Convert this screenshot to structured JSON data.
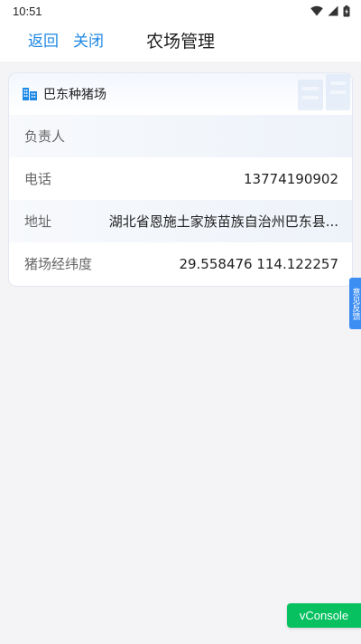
{
  "status_bar": {
    "time": "10:51"
  },
  "nav": {
    "back_label": "返回",
    "close_label": "关闭",
    "title": "农场管理"
  },
  "farm_card": {
    "name": "巴东种猪场",
    "rows": [
      {
        "label": "负责人",
        "value": ""
      },
      {
        "label": "电话",
        "value": "13774190902"
      },
      {
        "label": "地址",
        "value": "湖北省恩施土家族苗族自治州巴东县..."
      },
      {
        "label": "猪场经纬度",
        "value": "29.558476 114.122257"
      }
    ]
  },
  "feedback_tab": {
    "label": "意见反馈"
  },
  "vconsole": {
    "label": "vConsole"
  },
  "colors": {
    "accent": "#1e88e5",
    "vconsole": "#07c160",
    "feedback": "#3d8ef3"
  },
  "icons": [
    "wifi-icon",
    "signal-icon",
    "battery-icon",
    "building-icon"
  ]
}
